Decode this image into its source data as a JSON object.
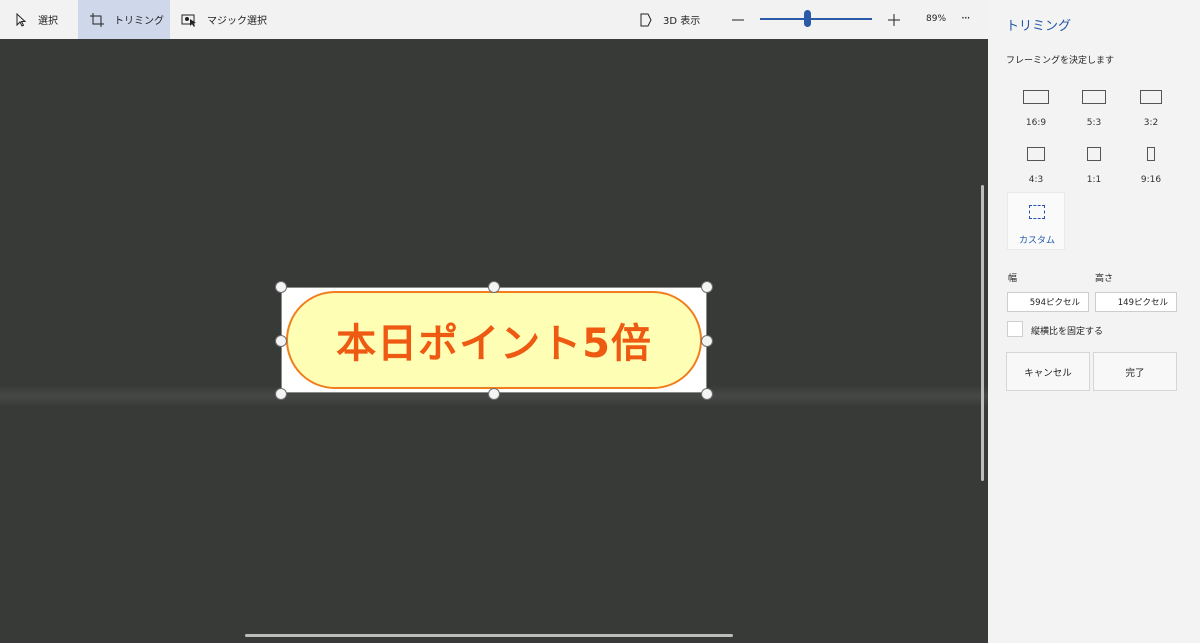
{
  "toolbar": {
    "select_label": "選択",
    "crop_label": "トリミング",
    "magic_select_label": "マジック選択",
    "view3d_label": "3D 表示",
    "zoom_value": "89%",
    "zoom_slider_fraction": 0.42,
    "more_label": "···"
  },
  "canvas": {
    "image_text": "本日ポイント5倍",
    "colors": {
      "background": "#383a38",
      "pill_fill": "#fffeb5",
      "pill_border": "#f07e1c",
      "pill_text": "#ee5a12"
    }
  },
  "panel": {
    "title": "トリミング",
    "subtitle": "フレーミングを決定します",
    "ratios": [
      {
        "label": "16:9"
      },
      {
        "label": "5:3"
      },
      {
        "label": "3:2"
      },
      {
        "label": "4:3"
      },
      {
        "label": "1:1"
      },
      {
        "label": "9:16"
      },
      {
        "label": "カスタム"
      }
    ],
    "width_label": "幅",
    "height_label": "高さ",
    "width_value": "594ピクセル",
    "height_value": "149ピクセル",
    "lock_aspect_label": "縦横比を固定する",
    "cancel_label": "キャンセル",
    "done_label": "完了",
    "accent_color": "#2156a8"
  }
}
